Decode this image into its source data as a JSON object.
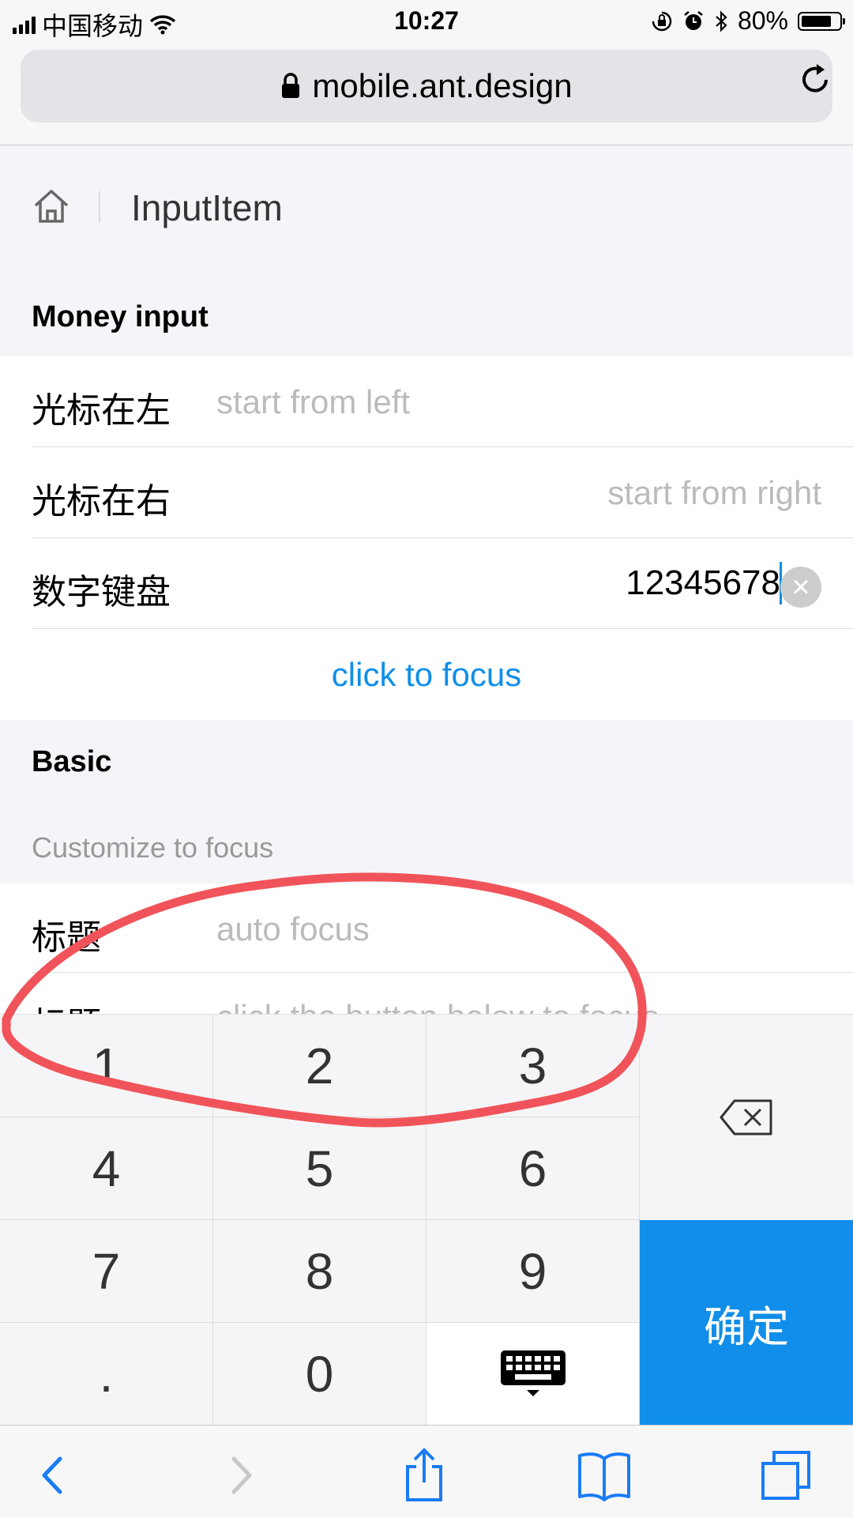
{
  "status_bar": {
    "carrier": "中国移动",
    "time": "10:27",
    "battery": "80%",
    "battery_level": 0.8,
    "icons": [
      "signal-icon",
      "wifi-icon",
      "orientation-lock-icon",
      "alarm-icon",
      "bluetooth-icon",
      "battery-icon"
    ]
  },
  "browser": {
    "url": "mobile.ant.design",
    "icons": [
      "lock-icon",
      "reload-icon"
    ]
  },
  "nav": {
    "title": "InputItem",
    "icon": "home-icon"
  },
  "money_section": {
    "title": "Money input",
    "rows": [
      {
        "label": "光标在左",
        "placeholder": "start from left"
      },
      {
        "label": "光标在右",
        "placeholder": "start from right"
      },
      {
        "label": "数字键盘",
        "value": "12345678"
      }
    ],
    "focus_link": "click to focus"
  },
  "basic_section": {
    "title": "Basic",
    "caption": "Customize to focus",
    "rows": [
      {
        "label": "标题",
        "placeholder": "auto focus"
      },
      {
        "label": "标题",
        "placeholder": "click the button below to focus"
      }
    ]
  },
  "keyboard": {
    "keys": [
      "1",
      "2",
      "3",
      "4",
      "5",
      "6",
      "7",
      "8",
      "9",
      ".",
      "0"
    ],
    "confirm": "确定",
    "icons": [
      "backspace-icon",
      "keyboard-hide-icon"
    ]
  },
  "toolbar": {
    "icons": [
      "back-icon",
      "forward-icon",
      "share-icon",
      "bookmarks-icon",
      "tabs-icon"
    ]
  },
  "colors": {
    "accent": "#108ee9",
    "annotation": "#f0545a"
  }
}
